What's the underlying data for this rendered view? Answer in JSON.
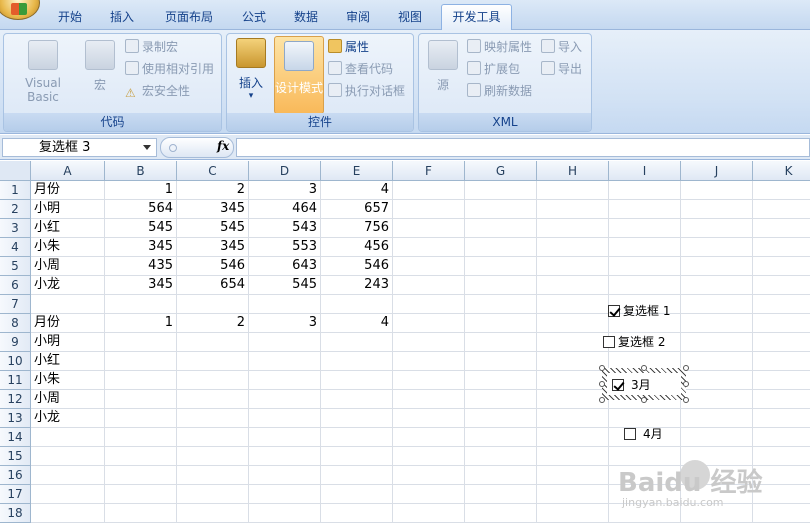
{
  "tabs": [
    "开始",
    "插入",
    "页面布局",
    "公式",
    "数据",
    "审阅",
    "视图",
    "开发工具"
  ],
  "ribbon": {
    "code": {
      "visual_basic": "Visual Basic",
      "macros": "宏",
      "record_macro": "录制宏",
      "relative_refs": "使用相对引用",
      "macro_security": "宏安全性",
      "label": "代码"
    },
    "controls": {
      "insert": "插入",
      "design_mode": "设计模式",
      "properties": "属性",
      "view_code": "查看代码",
      "run_dialog": "执行对话框",
      "label": "控件"
    },
    "xml": {
      "source": "源",
      "map_properties": "映射属性",
      "expansion_packs": "扩展包",
      "refresh_data": "刷新数据",
      "import": "导入",
      "export": "导出",
      "label": "XML"
    }
  },
  "formula_bar": {
    "name_box": "复选框 3",
    "fx": "fx",
    "formula": ""
  },
  "columns": [
    "A",
    "B",
    "C",
    "D",
    "E",
    "F",
    "G",
    "H",
    "I",
    "J",
    "K"
  ],
  "rows": [
    "1",
    "2",
    "3",
    "4",
    "5",
    "6",
    "7",
    "8",
    "9",
    "10",
    "11",
    "12",
    "13",
    "14",
    "15",
    "16",
    "17",
    "18"
  ],
  "cells": [
    [
      "月份",
      "1",
      "2",
      "3",
      "4"
    ],
    [
      "小明",
      "564",
      "345",
      "464",
      "657"
    ],
    [
      "小红",
      "545",
      "545",
      "543",
      "756"
    ],
    [
      "小朱",
      "345",
      "345",
      "553",
      "456"
    ],
    [
      "小周",
      "435",
      "546",
      "643",
      "546"
    ],
    [
      "小龙",
      "345",
      "654",
      "545",
      "243"
    ],
    [],
    [
      "月份",
      "1",
      "2",
      "3",
      "4"
    ],
    [
      "小明"
    ],
    [
      "小红"
    ],
    [
      "小朱"
    ],
    [
      "小周"
    ],
    [
      "小龙"
    ]
  ],
  "checkboxes": [
    {
      "label": "复选框 1",
      "checked": true
    },
    {
      "label": "复选框 2",
      "checked": false
    },
    {
      "label": "3月",
      "checked": true
    },
    {
      "label": "4月",
      "checked": false
    }
  ],
  "watermark": {
    "title": "Baidu 经验",
    "url": "jingyan.baidu.com"
  }
}
